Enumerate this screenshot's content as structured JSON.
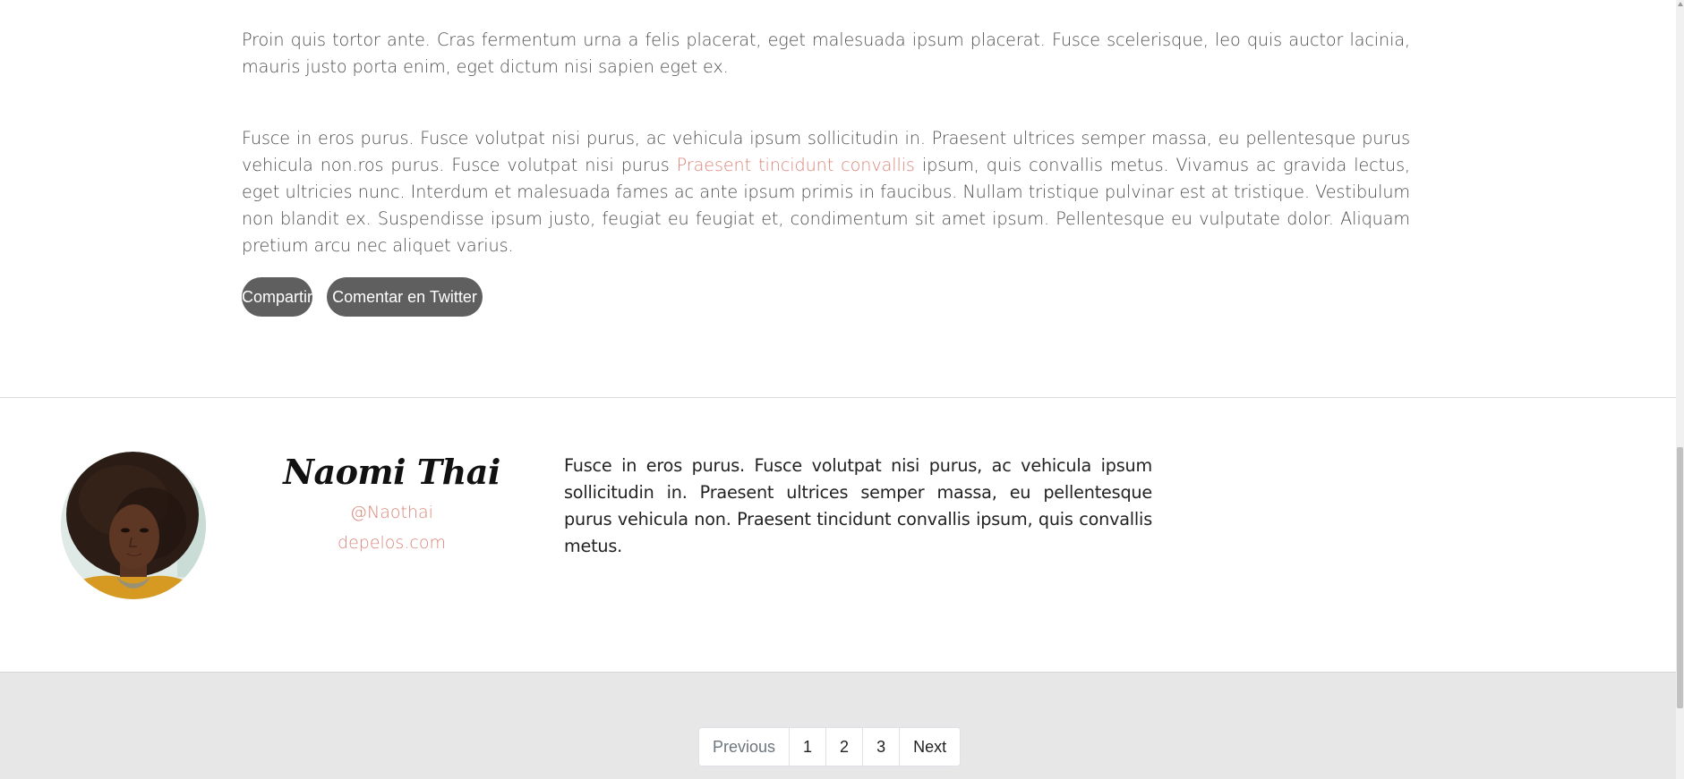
{
  "article": {
    "paragraph_1": "Proin quis tortor ante. Cras fermentum urna a felis placerat, eget malesuada ipsum placerat. Fusce scelerisque, leo quis auctor lacinia, mauris justo porta enim, eget dictum nisi sapien eget ex.",
    "paragraph_2_before_link": "Fusce in eros purus. Fusce volutpat nisi purus, ac vehicula ipsum sollicitudin in. Praesent ultrices semper massa, eu pellentesque purus vehicula non.ros purus. Fusce volutpat nisi purus ",
    "paragraph_2_link": "Praesent tincidunt convallis",
    "paragraph_2_after_link": " ipsum, quis convallis metus. Vivamus ac gravida lectus, eget ultricies nunc. Interdum et malesuada fames ac ante ipsum primis in faucibus. Nullam tristique pulvinar est at tristique. Vestibulum non blandit ex. Suspendisse ipsum justo, feugiat eu feugiat et, condimentum sit amet ipsum. Pellentesque eu vulputate dolor. Aliquam pretium arcu nec aliquet varius.",
    "share_label": "Compartir",
    "twitter_label": "Comentar en Twitter"
  },
  "author": {
    "name": "Naomi Thai",
    "handle": "@Naothai",
    "website": "depelos.com",
    "bio": "Fusce in eros purus. Fusce volutpat nisi purus, ac vehicula ipsum sollicitudin in. Praesent ultrices semper massa, eu pellentesque purus vehicula non. Praesent tincidunt convallis ipsum, quis convallis metus."
  },
  "pagination": {
    "previous": "Previous",
    "pages": [
      "1",
      "2",
      "3"
    ],
    "next": "Next"
  },
  "colors": {
    "link": "#d9857a",
    "button_bg": "#5f5f5f",
    "footer_bg": "#e6e7e6"
  }
}
